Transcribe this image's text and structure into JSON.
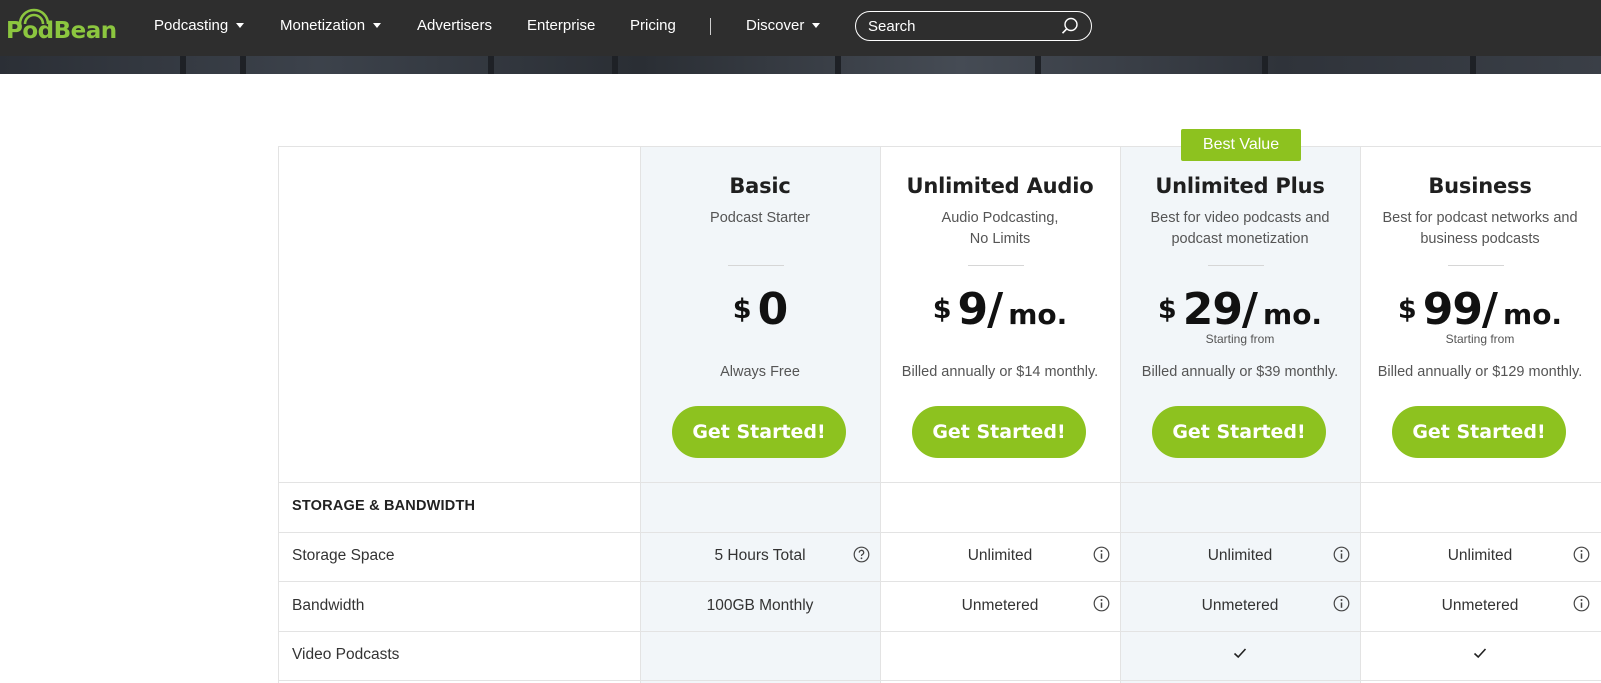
{
  "nav": {
    "logo": "PodBean",
    "items": [
      {
        "label": "Podcasting",
        "dropdown": true
      },
      {
        "label": "Monetization",
        "dropdown": true
      },
      {
        "label": "Advertisers",
        "dropdown": false
      },
      {
        "label": "Enterprise",
        "dropdown": false
      },
      {
        "label": "Pricing",
        "dropdown": false
      },
      {
        "label": "Discover",
        "dropdown": true
      }
    ],
    "search_placeholder": "Search"
  },
  "colors": {
    "accent": "#8dc21f",
    "nav_bg": "#2e2e2e",
    "highlight_col": "#f2f6f9"
  },
  "badge": "Best Value",
  "plans": [
    {
      "name": "Basic",
      "subtitle": "Podcast Starter",
      "currency": "$",
      "amount": "0",
      "period": "",
      "starting": "",
      "billing": "Always Free",
      "cta": "Get Started!"
    },
    {
      "name": "Unlimited Audio",
      "subtitle": "Audio Podcasting, No Limits",
      "currency": "$",
      "amount": "9/",
      "period": "mo.",
      "starting": "",
      "billing": "Billed annually or $14 monthly.",
      "cta": "Get Started!"
    },
    {
      "name": "Unlimited Plus",
      "subtitle": "Best for video podcasts and podcast monetization",
      "currency": "$",
      "amount": "29/",
      "period": "mo.",
      "starting": "Starting from",
      "billing": "Billed annually or $39 monthly.",
      "cta": "Get Started!"
    },
    {
      "name": "Business",
      "subtitle": "Best for podcast networks and business podcasts",
      "currency": "$",
      "amount": "99/",
      "period": "mo.",
      "starting": "Starting from",
      "billing": "Billed annually or $129 monthly.",
      "cta": "Get Started!"
    }
  ],
  "section": "STORAGE & BANDWIDTH",
  "rows": [
    {
      "label": "Storage Space",
      "values": [
        "5 Hours Total",
        "Unlimited",
        "Unlimited",
        "Unlimited"
      ],
      "icons": [
        "help-icon",
        "info-icon",
        "info-icon",
        "info-icon"
      ]
    },
    {
      "label": "Bandwidth",
      "values": [
        "100GB Monthly",
        "Unmetered",
        "Unmetered",
        "Unmetered"
      ],
      "icons": [
        "",
        "info-icon",
        "info-icon",
        "info-icon"
      ]
    },
    {
      "label": "Video Podcasts",
      "values": [
        "",
        "",
        "check",
        "check"
      ],
      "icons": [
        "",
        "",
        "",
        ""
      ]
    }
  ]
}
